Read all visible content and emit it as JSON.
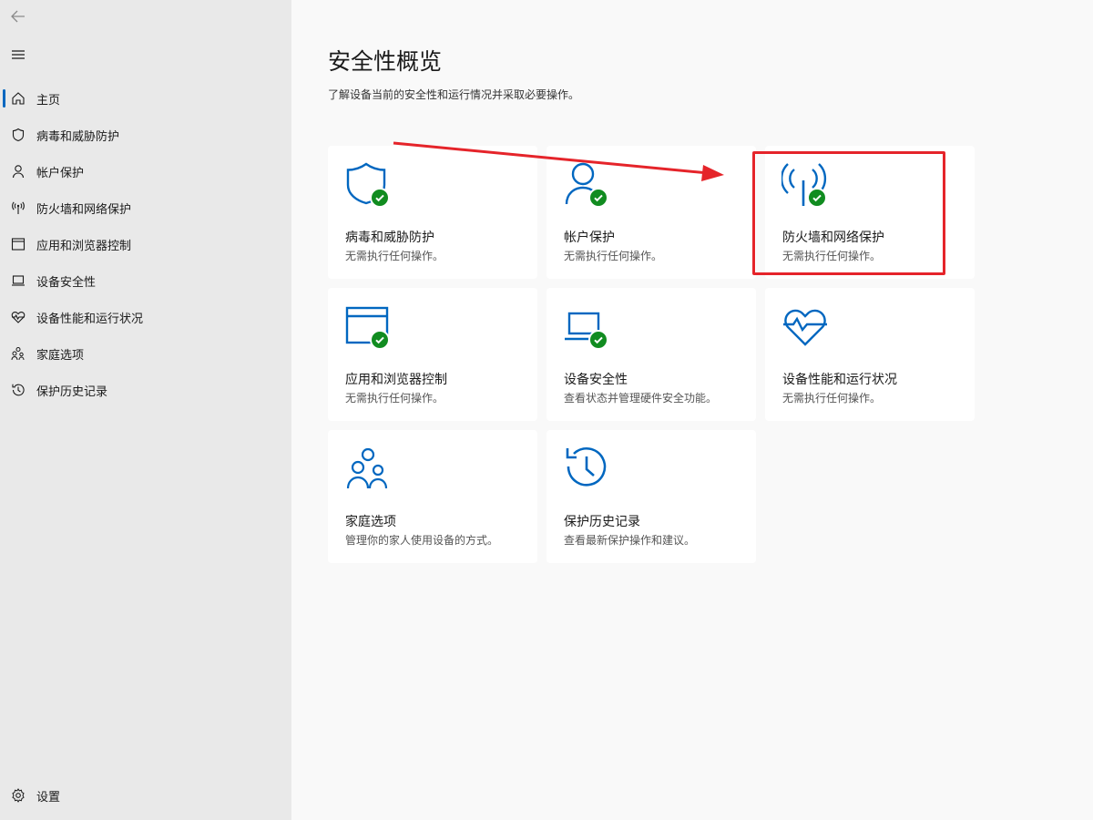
{
  "sidebar": {
    "back_icon": "back-arrow-icon",
    "menu_icon": "hamburger-menu-icon",
    "items": [
      {
        "label": "主页",
        "icon": "home-icon",
        "active": true
      },
      {
        "label": "病毒和威胁防护",
        "icon": "shield-icon"
      },
      {
        "label": "帐户保护",
        "icon": "person-icon"
      },
      {
        "label": "防火墙和网络保护",
        "icon": "antenna-icon"
      },
      {
        "label": "应用和浏览器控制",
        "icon": "app-window-icon"
      },
      {
        "label": "设备安全性",
        "icon": "laptop-icon"
      },
      {
        "label": "设备性能和运行状况",
        "icon": "heart-pulse-icon"
      },
      {
        "label": "家庭选项",
        "icon": "family-icon"
      },
      {
        "label": "保护历史记录",
        "icon": "history-icon"
      }
    ],
    "settings": {
      "label": "设置",
      "icon": "gear-icon"
    }
  },
  "main": {
    "title": "安全性概览",
    "subtitle": "了解设备当前的安全性和运行情况并采取必要操作。",
    "cards": [
      {
        "title": "病毒和威胁防护",
        "desc": "无需执行任何操作。",
        "icon": "shield-icon",
        "status": "ok"
      },
      {
        "title": "帐户保护",
        "desc": "无需执行任何操作。",
        "icon": "person-icon",
        "status": "ok"
      },
      {
        "title": "防火墙和网络保护",
        "desc": "无需执行任何操作。",
        "icon": "antenna-icon",
        "status": "ok"
      },
      {
        "title": "应用和浏览器控制",
        "desc": "无需执行任何操作。",
        "icon": "app-window-icon",
        "status": "ok"
      },
      {
        "title": "设备安全性",
        "desc": "查看状态并管理硬件安全功能。",
        "icon": "laptop-icon",
        "status": "ok"
      },
      {
        "title": "设备性能和运行状况",
        "desc": "无需执行任何操作。",
        "icon": "heart-pulse-icon",
        "status": "none"
      },
      {
        "title": "家庭选项",
        "desc": "管理你的家人使用设备的方式。",
        "icon": "family-icon",
        "status": "none"
      },
      {
        "title": "保护历史记录",
        "desc": "查看最新保护操作和建议。",
        "icon": "history-icon",
        "status": "none"
      }
    ]
  },
  "colors": {
    "accent": "#0067c0",
    "check": "#118c20",
    "annotation": "#e5242a",
    "sidebar_bg": "#e9e9e9",
    "main_bg": "#f9f9f9"
  }
}
